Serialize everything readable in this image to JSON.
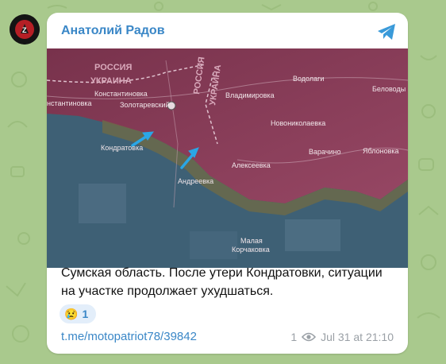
{
  "post": {
    "author": "Анатолий Радов",
    "text": "Сумская область. После утери Кондратовки, ситуации на участке продолжает ухудшаться.",
    "reaction": {
      "emoji": "😢",
      "count": "1"
    },
    "link": "t.me/motopatriot78/39842",
    "views": "1",
    "date": "Jul 31 at 21:10"
  },
  "map": {
    "labels": {
      "russia": "РОССИЯ",
      "ukraine_h": "УКРАИНА",
      "russia_v": "РОССИЯ",
      "ukraine_v": "УКРАИНА",
      "konstantinovka": "Константиновка",
      "konstantinovka2": "нстантиновка",
      "zolotarevsky": "Золотаревский",
      "kondratovka": "Кондратовка",
      "andreevka": "Андреевка",
      "alekseevka": "Алексеевка",
      "vladimirovka": "Владимировка",
      "novonikolaevka": "Новониколаевка",
      "varachino": "Варачино",
      "yablonovka": "Яблоновка",
      "vodolagi": "Водолаги",
      "belovody": "Беловоды",
      "malaya": "Малая",
      "korchakovka": "Корчаковка"
    },
    "colors": {
      "russian_zone": "#8c3b57",
      "ukrainian_zone": "#3d5f78",
      "contested": "#6b6a4a",
      "arrow": "#2aa6e6"
    }
  },
  "icons": {
    "share": "telegram-share-icon",
    "views": "eye-icon"
  }
}
